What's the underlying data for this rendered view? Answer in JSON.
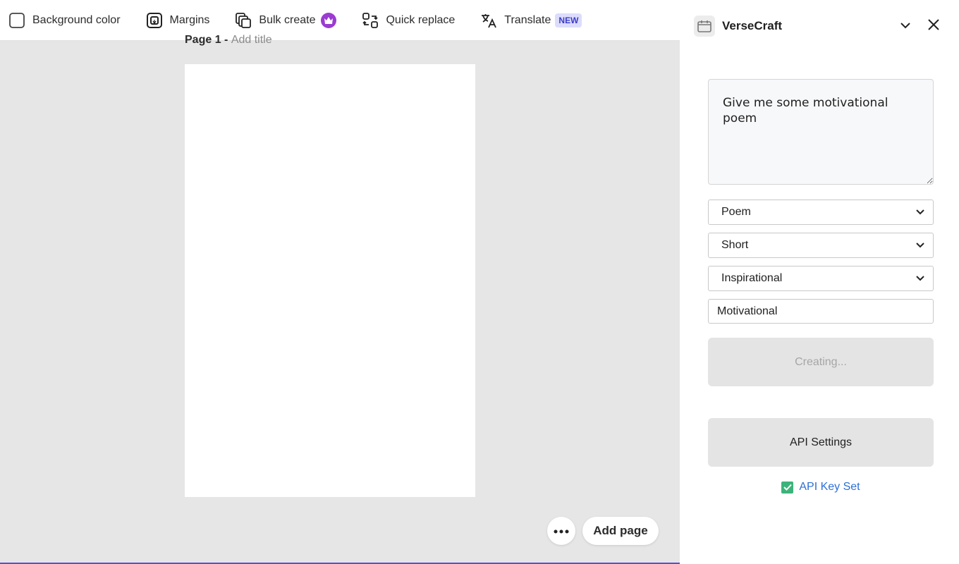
{
  "toolbar": {
    "items": [
      {
        "label": "Background color",
        "icon": "checkbox-square-icon"
      },
      {
        "label": "Margins",
        "icon": "margins-icon"
      },
      {
        "label": "Bulk create",
        "icon": "bulk-create-icon",
        "badge_icon": "crown-icon",
        "badge_color": "#9b3bd1"
      },
      {
        "label": "Quick replace",
        "icon": "quick-replace-icon"
      },
      {
        "label": "Translate",
        "icon": "translate-icon",
        "badge": "NEW"
      }
    ]
  },
  "canvas": {
    "page_label": "Page 1 -",
    "add_title_placeholder": "Add title",
    "more_icon": "ellipsis-icon",
    "add_page_label": "Add page"
  },
  "panel": {
    "app_name": "VerseCraft",
    "app_icon": "calendar-icon",
    "collapse_icon": "chevron-down-icon",
    "close_icon": "close-icon",
    "prompt_value": "Give me some motivational poem",
    "selects": [
      {
        "value": "Poem"
      },
      {
        "value": "Short"
      },
      {
        "value": "Inspirational"
      }
    ],
    "text_input_value": "Motivational",
    "creating_label": "Creating...",
    "api_settings_label": "API Settings",
    "api_status_label": "API Key Set",
    "api_status_icon": "checkmark-icon"
  },
  "colors": {
    "accent": "#5a4fcf",
    "link": "#2e6fd6",
    "success": "#3db37a",
    "premium": "#9b3bd1"
  }
}
